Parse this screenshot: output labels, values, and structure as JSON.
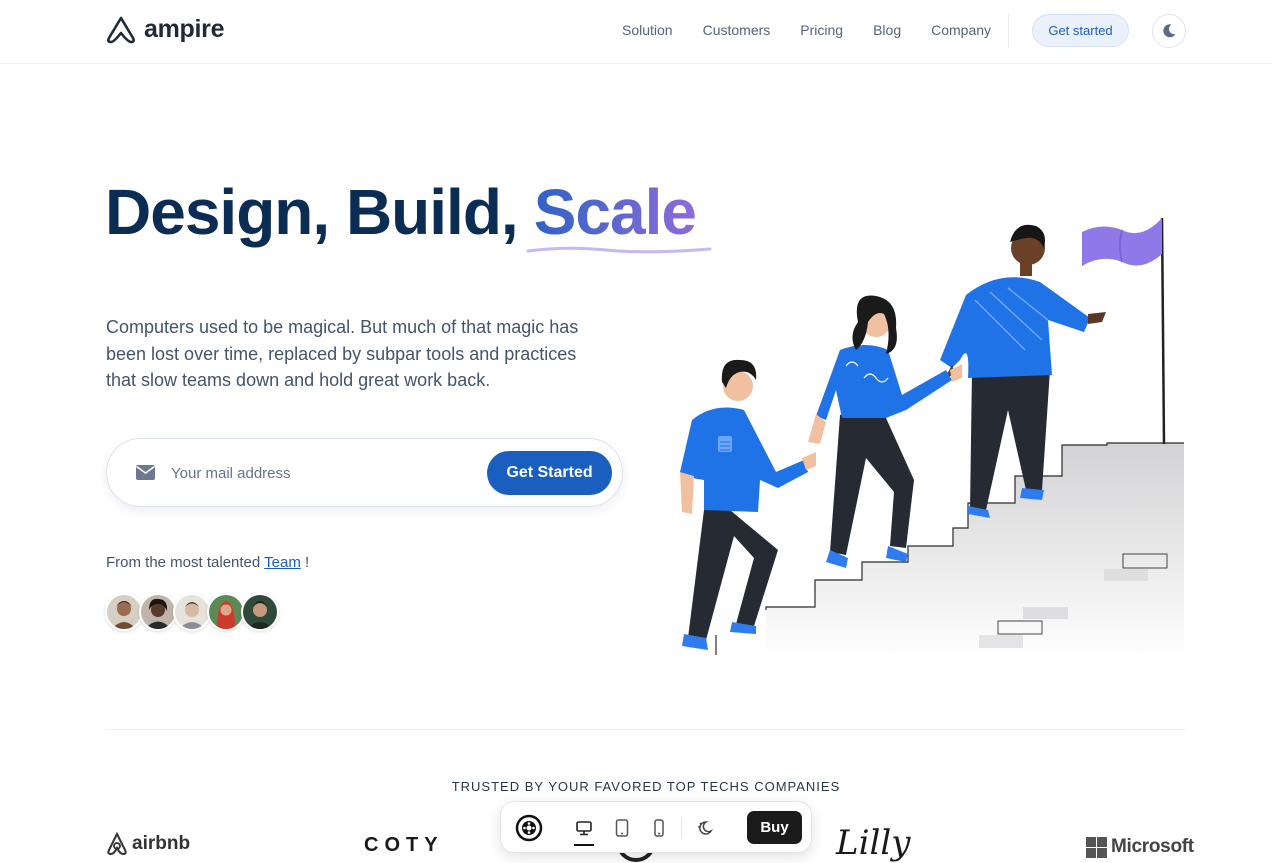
{
  "header": {
    "logo_text": "ampire",
    "nav": [
      "Solution",
      "Customers",
      "Pricing",
      "Blog",
      "Company"
    ],
    "cta_label": "Get started",
    "theme_icon": "moon-icon"
  },
  "hero": {
    "title_part1": "Design, Build,",
    "title_accent": "Scale",
    "description": "Computers used to be magical. But much of that magic has been lost over time, replaced by subpar tools and practices that slow teams down and hold great work back.",
    "email_placeholder": "Your mail address",
    "email_icon": "mail-icon",
    "cta_label": "Get Started",
    "team_prefix": "From the most talented",
    "team_link": "Team",
    "team_suffix": "!",
    "avatar_colors": [
      "#9a6b4c",
      "#3b2a22",
      "#c8b7a6",
      "#d04a3c",
      "#2f4a3a"
    ]
  },
  "trusted": {
    "title": "TRUSTED BY YOUR FAVORED TOP TECHS COMPANIES",
    "logos": [
      "airbnb",
      "COTY",
      "Lilly",
      "Microsoft"
    ]
  },
  "toolbar": {
    "buy_label": "Buy",
    "icons": [
      "settings-icon",
      "desktop-icon",
      "tablet-icon",
      "mobile-icon",
      "theme-toggle-icon"
    ]
  },
  "colors": {
    "primary": "#1a5fbf",
    "heading": "#0b2d54",
    "accent_gradient_start": "#2f63c5",
    "accent_gradient_end": "#8f6bd9",
    "flag": "#8f79e8"
  }
}
